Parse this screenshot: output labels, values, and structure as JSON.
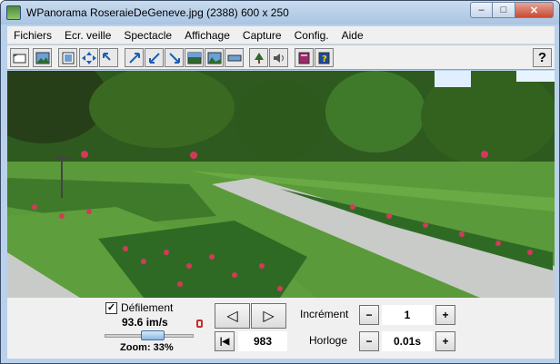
{
  "window": {
    "title": "WPanorama  RoseraieDeGeneve.jpg   (2388) 600 x 250",
    "controls": {
      "minimize": "–",
      "maximize": "□",
      "close": "✕"
    }
  },
  "menu": [
    "Fichiers",
    "Ecr. veille",
    "Spectacle",
    "Affichage",
    "Capture",
    "Config.",
    "Aide"
  ],
  "toolbar": {
    "icons": [
      "open-icon",
      "image-icon",
      "panorama-icon",
      "move-icon",
      "zoom-out-icon",
      "arrow-up-right-icon",
      "arrow-down-left-icon",
      "arrow-down-right-icon",
      "fit-icon",
      "landscape-icon",
      "strip-icon",
      "tree-icon",
      "sound-icon",
      "book-icon",
      "help-book-icon"
    ],
    "help_label": "?"
  },
  "photo": {
    "description_label": ""
  },
  "controls": {
    "scroll_checked": "✓",
    "scroll_label": "Défilement",
    "speed": "93.6 im/s",
    "zoom": "Zoom: 33%",
    "slider_level": 0.55,
    "prev_glyph": "◁",
    "next_glyph": "▷",
    "first_glyph": "|◀",
    "position": "983",
    "increment_label": "Incrément",
    "increment_value": "1",
    "clock_label": "Horloge",
    "clock_value": "0.01s",
    "minus": "−",
    "plus": "+"
  },
  "colors": {
    "frame": "#b9d1ea",
    "sky": "#eaf6ff",
    "foliage": "#2f5a1f",
    "lawn": "#5a9a3a",
    "path": "#c9cbc8",
    "roses": "#d33a5a"
  }
}
